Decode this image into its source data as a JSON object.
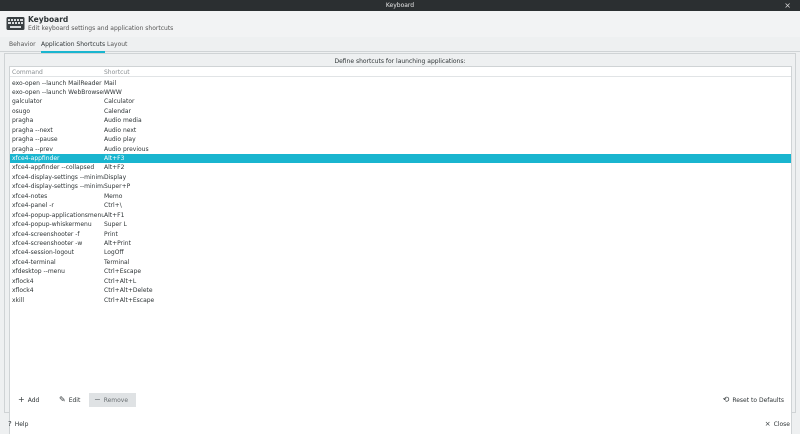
{
  "window": {
    "title": "Keyboard"
  },
  "header": {
    "app_name": "Keyboard",
    "subtitle": "Edit keyboard settings and application shortcuts"
  },
  "tabs": [
    {
      "label": "Behavior"
    },
    {
      "label": "Application Shortcuts"
    },
    {
      "label": "Layout"
    }
  ],
  "panel": {
    "description": "Define shortcuts for launching applications:",
    "columns": {
      "command": "Command",
      "shortcut": "Shortcut"
    },
    "rows": [
      {
        "command": "exo-open --launch MailReader",
        "shortcut": "Mail",
        "selected": false
      },
      {
        "command": "exo-open --launch WebBrowser",
        "shortcut": "WWW",
        "selected": false
      },
      {
        "command": "galculator",
        "shortcut": "Calculator",
        "selected": false
      },
      {
        "command": "osugo",
        "shortcut": "Calendar",
        "selected": false
      },
      {
        "command": "pragha",
        "shortcut": "Audio media",
        "selected": false
      },
      {
        "command": "pragha --next",
        "shortcut": "Audio next",
        "selected": false
      },
      {
        "command": "pragha --pause",
        "shortcut": "Audio play",
        "selected": false
      },
      {
        "command": "pragha --prev",
        "shortcut": "Audio previous",
        "selected": false
      },
      {
        "command": "xfce4-appfinder",
        "shortcut": "Alt+F3",
        "selected": true
      },
      {
        "command": "xfce4-appfinder --collapsed",
        "shortcut": "Alt+F2",
        "selected": false
      },
      {
        "command": "xfce4-display-settings --minimal",
        "shortcut": "Display",
        "selected": false
      },
      {
        "command": "xfce4-display-settings --minimal",
        "shortcut": "Super+P",
        "selected": false
      },
      {
        "command": "xfce4-notes",
        "shortcut": "Memo",
        "selected": false
      },
      {
        "command": "xfce4-panel -r",
        "shortcut": "Ctrl+\\",
        "selected": false
      },
      {
        "command": "xfce4-popup-applicationsmenu",
        "shortcut": "Alt+F1",
        "selected": false
      },
      {
        "command": "xfce4-popup-whiskermenu",
        "shortcut": "Super L",
        "selected": false
      },
      {
        "command": "xfce4-screenshooter -f",
        "shortcut": "Print",
        "selected": false
      },
      {
        "command": "xfce4-screenshooter -w",
        "shortcut": "Alt+Print",
        "selected": false
      },
      {
        "command": "xfce4-session-logout",
        "shortcut": "LogOff",
        "selected": false
      },
      {
        "command": "xfce4-terminal",
        "shortcut": "Terminal",
        "selected": false
      },
      {
        "command": "xfdesktop --menu",
        "shortcut": "Ctrl+Escape",
        "selected": false
      },
      {
        "command": "xflock4",
        "shortcut": "Ctrl+Alt+L",
        "selected": false
      },
      {
        "command": "xflock4",
        "shortcut": "Ctrl+Alt+Delete",
        "selected": false
      },
      {
        "command": "xkill",
        "shortcut": "Ctrl+Alt+Escape",
        "selected": false
      }
    ]
  },
  "toolbar": {
    "add_label": "Add",
    "edit_label": "Edit",
    "remove_label": "Remove",
    "reset_label": "Reset to Defaults"
  },
  "footer": {
    "help_label": "Help",
    "close_label": "Close"
  },
  "icons": {
    "app": "keyboard-icon",
    "add": "plus-icon",
    "edit": "pencil-icon",
    "remove": "minus-icon",
    "reset": "reset-icon",
    "help": "help-icon",
    "close": "close-icon"
  },
  "colors": {
    "accent": "#19b5cf",
    "titlebar": "#2b2f31"
  }
}
